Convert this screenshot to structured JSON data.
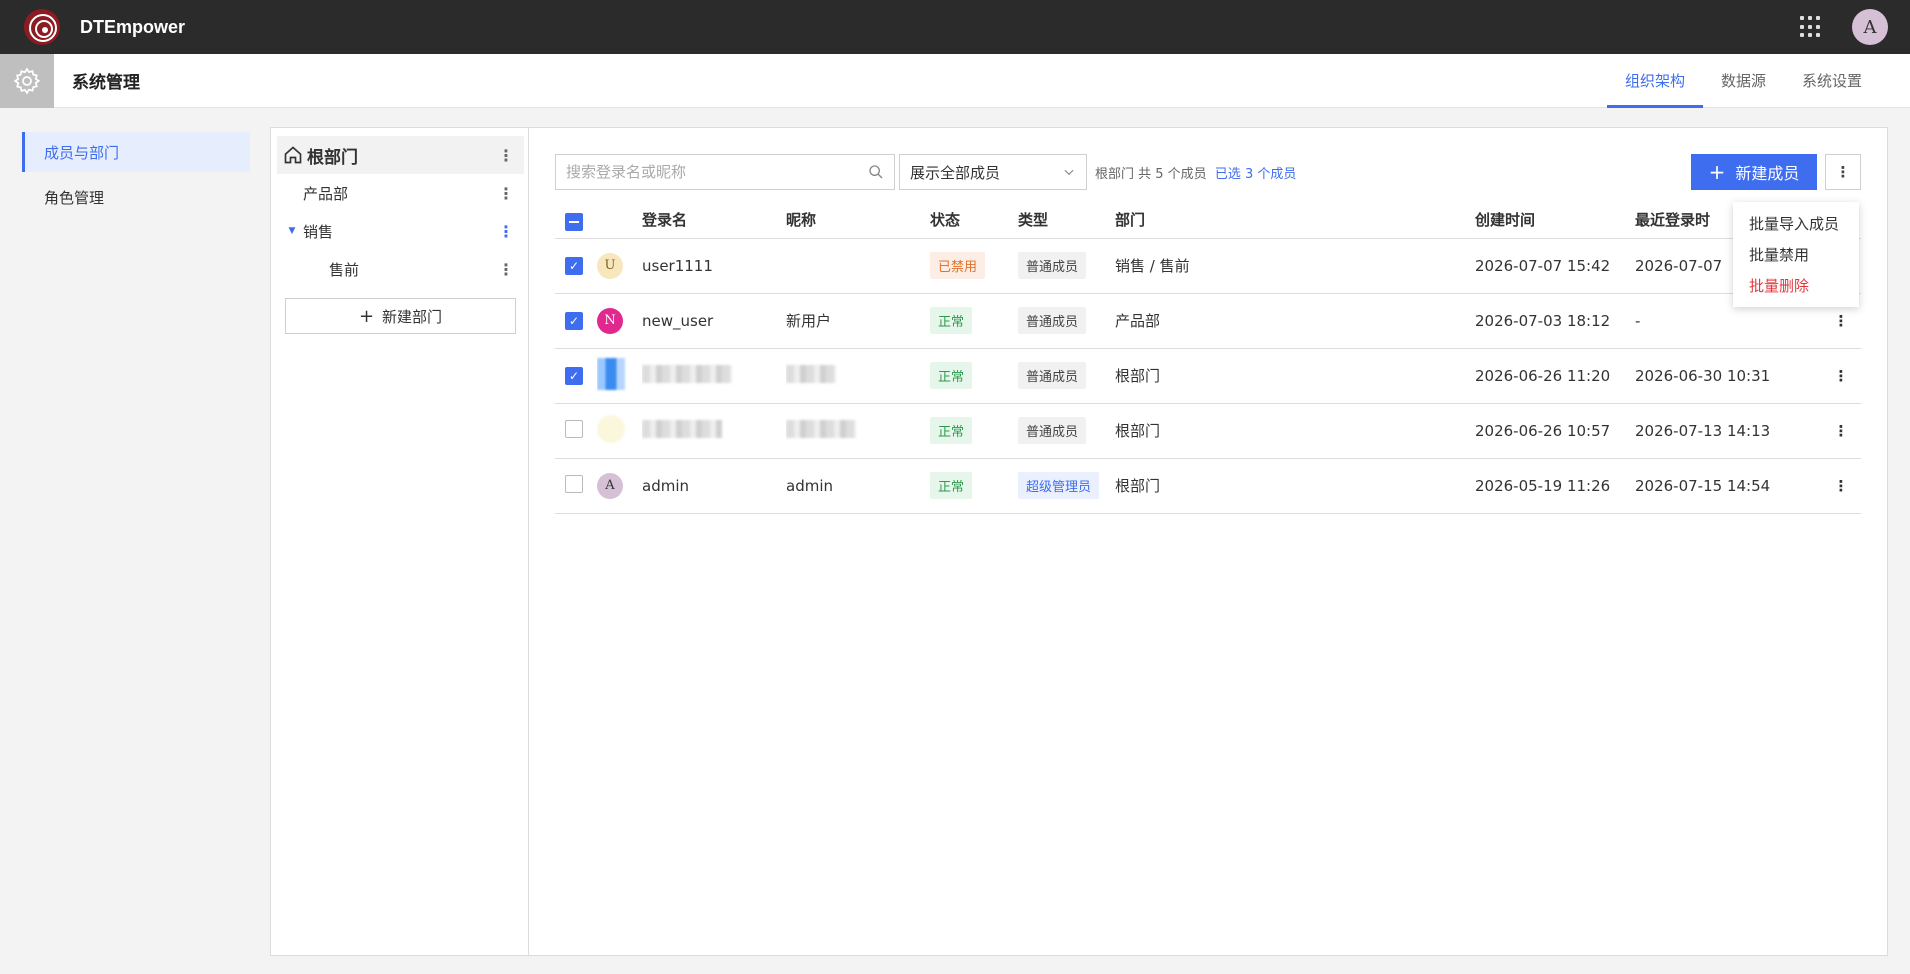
{
  "topbar": {
    "app_name": "DTEmpower",
    "avatar_letter": "A"
  },
  "header": {
    "title": "系统管理",
    "tabs": [
      {
        "label": "组织架构",
        "active": true
      },
      {
        "label": "数据源",
        "active": false
      },
      {
        "label": "系统设置",
        "active": false
      }
    ]
  },
  "sidebar": {
    "items": [
      {
        "label": "成员与部门",
        "active": true
      },
      {
        "label": "角色管理",
        "active": false
      }
    ]
  },
  "departments": {
    "root": "根部门",
    "items": [
      {
        "label": "产品部"
      },
      {
        "label": "销售"
      },
      {
        "label": "售前"
      }
    ],
    "new_button": "新建部门"
  },
  "toolbar": {
    "search_placeholder": "搜索登录名或昵称",
    "filter_value": "展示全部成员",
    "summary": "根部门 共 5 个成员",
    "selected": "已选 3 个成员",
    "new_member": "新建成员"
  },
  "table": {
    "headers": {
      "login": "登录名",
      "nickname": "昵称",
      "status": "状态",
      "type": "类型",
      "dept": "部门",
      "created": "创建时间",
      "last_login": "最近登录时"
    },
    "rows": [
      {
        "avatar": "U",
        "avatar_color": "#f8e7bd",
        "login": "user1111",
        "nickname": "",
        "status": "已禁用",
        "type": "普通成员",
        "dept": "销售 / 售前",
        "created": "2026-07-07 15:42",
        "last_login": "2026-07-07"
      },
      {
        "avatar": "N",
        "avatar_color": "#e0288e",
        "login": "new_user",
        "nickname": "新用户",
        "status": "正常",
        "type": "普通成员",
        "dept": "产品部",
        "created": "2026-07-03 18:12",
        "last_login": "-"
      },
      {
        "avatar": "",
        "login": "",
        "nickname": "",
        "status": "正常",
        "type": "普通成员",
        "dept": "根部门",
        "created": "2026-06-26 11:20",
        "last_login": "2026-06-30 10:31"
      },
      {
        "avatar": "",
        "login": "",
        "nickname": "",
        "status": "正常",
        "type": "普通成员",
        "dept": "根部门",
        "created": "2026-06-26 10:57",
        "last_login": "2026-07-13 14:13"
      },
      {
        "avatar": "A",
        "avatar_color": "#d5c0d6",
        "login": "admin",
        "nickname": "admin",
        "status": "正常",
        "type": "超级管理员",
        "dept": "根部门",
        "created": "2026-05-19 11:26",
        "last_login": "2026-07-15 14:54"
      }
    ]
  },
  "dropdown": {
    "items": [
      "批量导入成员",
      "批量禁用",
      "批量删除"
    ]
  }
}
